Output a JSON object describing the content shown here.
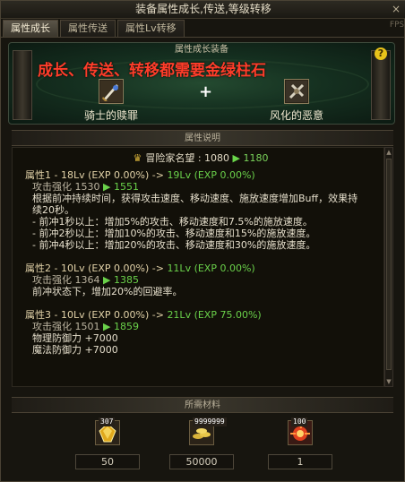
{
  "window": {
    "title": "装备属性成长,传送,等级转移",
    "close_label": "×",
    "fps_label": "FPS"
  },
  "tabs": [
    {
      "label": "属性成长",
      "active": true
    },
    {
      "label": "属性传送",
      "active": false
    },
    {
      "label": "属性Lv转移",
      "active": false
    }
  ],
  "banner": {
    "header": "属性成长装备",
    "slogan": "成长、传送、转移都需要金绿柱石",
    "help": "?",
    "plus": "+",
    "left_item": {
      "name": "骑士的赎罪",
      "icon": "knight-redemption-icon"
    },
    "right_item": {
      "name": "风化的恶意",
      "icon": "weathered-malice-icon"
    }
  },
  "attributes": {
    "header": "属性说明",
    "fame": {
      "label": "冒险家名望 : 1080",
      "arrow": "▶",
      "new_value": "1180"
    },
    "groups": [
      {
        "title": "属性1 - 18Lv (EXP 0.00%)",
        "arrow": "->",
        "new": "19Lv (EXP 0.00%)",
        "stat": "攻击强化 1530",
        "stat_arrow": "▶",
        "stat_new": "1551",
        "desc": "根据前冲持续时间，获得攻击速度、移动速度、施放速度增加Buff，效果持续20秒。",
        "lines": [
          "- 前冲1秒以上：增加5%的攻击、移动速度和7.5%的施放速度。",
          "- 前冲2秒以上：增加10%的攻击、移动速度和15%的施放速度。",
          "- 前冲4秒以上：增加20%的攻击、移动速度和30%的施放速度。"
        ]
      },
      {
        "title": "属性2 - 10Lv (EXP 0.00%)",
        "arrow": "->",
        "new": "11Lv (EXP 0.00%)",
        "stat": "攻击强化 1364",
        "stat_arrow": "▶",
        "stat_new": "1385",
        "desc": "前冲状态下，增加20%的回避率。"
      },
      {
        "title": "属性3 - 10Lv (EXP 0.00%)",
        "arrow": "->",
        "new": "21Lv (EXP 75.00%)",
        "stat": "攻击强化 1501",
        "stat_arrow": "▶",
        "stat_new": "1859",
        "lines": [
          "物理防御力 +7000",
          "魔法防御力 +7000"
        ]
      }
    ]
  },
  "materials": {
    "header": "所需材料",
    "items": [
      {
        "icon": "golden-beryl-icon",
        "badge": "307",
        "count": "50"
      },
      {
        "icon": "gold-coins-icon",
        "badge": "9999999",
        "count": "50000"
      },
      {
        "icon": "explosion-stone-icon",
        "badge": "100",
        "count": "1"
      }
    ]
  }
}
